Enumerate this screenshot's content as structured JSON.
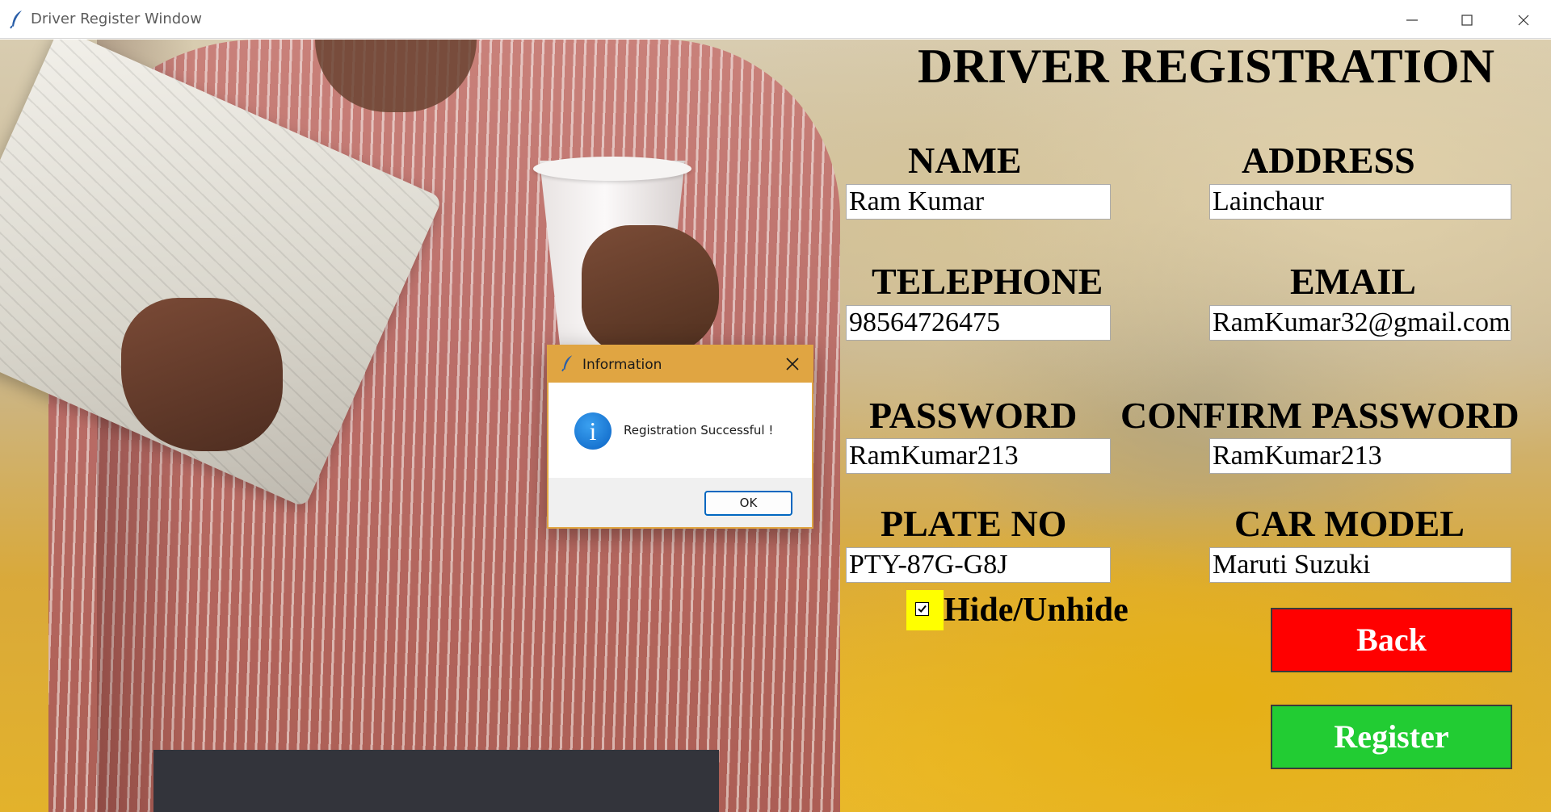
{
  "window": {
    "title": "Driver Register Window",
    "icon": "feather-icon"
  },
  "form": {
    "heading": "DRIVER REGISTRATION",
    "fields": {
      "name": {
        "label": "NAME",
        "value": "Ram Kumar"
      },
      "address": {
        "label": "ADDRESS",
        "value": "Lainchaur"
      },
      "telephone": {
        "label": "TELEPHONE",
        "value": "98564726475"
      },
      "email": {
        "label": "EMAIL",
        "value": "RamKumar32@gmail.com"
      },
      "password": {
        "label": "PASSWORD",
        "value": "RamKumar213"
      },
      "confirm_password": {
        "label": "CONFIRM PASSWORD",
        "value": "RamKumar213"
      },
      "plate_no": {
        "label": "PLATE NO",
        "value": "PTY-87G-G8J"
      },
      "car_model": {
        "label": "CAR MODEL",
        "value": "Maruti Suzuki"
      }
    },
    "hide_unhide": {
      "label": "Hide/Unhide",
      "checked": true
    },
    "buttons": {
      "back": "Back",
      "register": "Register"
    },
    "colors": {
      "back_button": "#ff0000",
      "register_button": "#22cc33",
      "checkbox_highlight": "#ffff00"
    }
  },
  "dialog": {
    "title": "Information",
    "message": "Registration Successful !",
    "ok_label": "OK",
    "icon": "info-icon",
    "accent": "#e0a542"
  }
}
